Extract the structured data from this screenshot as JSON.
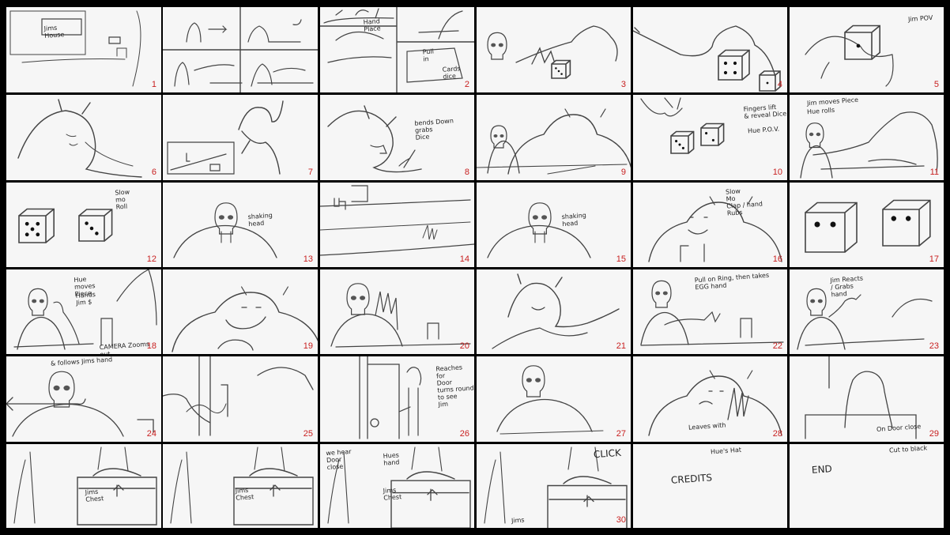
{
  "panels": [
    {
      "num": "1",
      "notes": [
        "Jims\nHouse"
      ],
      "sketch": "room"
    },
    {
      "num": "",
      "notes": [],
      "sketch": "quad"
    },
    {
      "num": "2",
      "notes": [
        "Hand\nPlace",
        "Pull\nin",
        "Cards\ndice"
      ],
      "sketch": "table-overhead"
    },
    {
      "num": "3",
      "notes": [],
      "sketch": "skull-dice"
    },
    {
      "num": "4",
      "notes": [],
      "sketch": "arm-dice"
    },
    {
      "num": "5",
      "notes": [
        "Jim POV"
      ],
      "sketch": "die-line"
    },
    {
      "num": "6",
      "notes": [],
      "sketch": "ogre-side"
    },
    {
      "num": "7",
      "notes": [],
      "sketch": "ogre-drink"
    },
    {
      "num": "8",
      "notes": [
        "bends Down\ngrabs\nDice"
      ],
      "sketch": "ogre-bend"
    },
    {
      "num": "9",
      "notes": [],
      "sketch": "ogre-table"
    },
    {
      "num": "10",
      "notes": [
        "Fingers lift\n& reveal Dice",
        "Hue P.O.V."
      ],
      "sketch": "dice-pair-small"
    },
    {
      "num": "11",
      "notes": [
        "Jim moves Piece",
        "Hue rolls"
      ],
      "sketch": "skeleton-table"
    },
    {
      "num": "12",
      "notes": [
        "Slow\nmo\nRoll"
      ],
      "sketch": "dice-roll"
    },
    {
      "num": "13",
      "notes": [
        "shaking\nhead"
      ],
      "sketch": "skeleton"
    },
    {
      "num": "14",
      "notes": [],
      "sketch": "road"
    },
    {
      "num": "15",
      "notes": [
        "shaking\nhead"
      ],
      "sketch": "skeleton"
    },
    {
      "num": "16",
      "notes": [
        "Slow\nMo\nClap / hand\nRubs"
      ],
      "sketch": "ogre-smile"
    },
    {
      "num": "17",
      "notes": [],
      "sketch": "dice-big"
    },
    {
      "num": "18",
      "notes": [
        "Hue\nmoves\nPiece",
        "Hands\nJim $",
        "CAMERA Zooms\nout"
      ],
      "sketch": "skeleton-hand"
    },
    {
      "num": "19",
      "notes": [],
      "sketch": "ogre-chin"
    },
    {
      "num": "20",
      "notes": [],
      "sketch": "skeleton-claw"
    },
    {
      "num": "21",
      "notes": [],
      "sketch": "ogre-point"
    },
    {
      "num": "22",
      "notes": [
        "Pull on Ring, then takes\nEGG hand"
      ],
      "sketch": "skeleton-ring"
    },
    {
      "num": "23",
      "notes": [
        "Jim Reacts\n/ Grabs\nhand"
      ],
      "sketch": "skeleton-grab"
    },
    {
      "num": "24",
      "notes": [
        "& follows Jims hand"
      ],
      "sketch": "skeleton-arrow"
    },
    {
      "num": "25",
      "notes": [],
      "sketch": "door-wide"
    },
    {
      "num": "26",
      "notes": [
        "Reaches\nfor\nDoor\nturns round\nto see\nJim"
      ],
      "sketch": "door-figure"
    },
    {
      "num": "27",
      "notes": [],
      "sketch": "skeleton-plain"
    },
    {
      "num": "28",
      "notes": [
        "Leaves with"
      ],
      "sketch": "ogre-leave"
    },
    {
      "num": "29",
      "notes": [
        "On Door close"
      ],
      "sketch": "back"
    },
    {
      "num": "",
      "notes": [
        "Jims\nChest"
      ],
      "sketch": "chest-far"
    },
    {
      "num": "",
      "notes": [
        "Jims\nChest"
      ],
      "sketch": "chest-mid"
    },
    {
      "num": "",
      "notes": [
        "we hear\nDoor\nclose",
        "Hues\nhand",
        "Jims\nChest"
      ],
      "sketch": "chest-close"
    },
    {
      "num": "30",
      "notes": [
        "CLICK",
        "Jims"
      ],
      "sketch": "chest-lock"
    },
    {
      "num": "",
      "notes": [
        "Hue's Hat",
        "CREDITS"
      ],
      "sketch": "blank"
    },
    {
      "num": "",
      "notes": [
        "Cut to black",
        "END"
      ],
      "sketch": "blank"
    }
  ]
}
